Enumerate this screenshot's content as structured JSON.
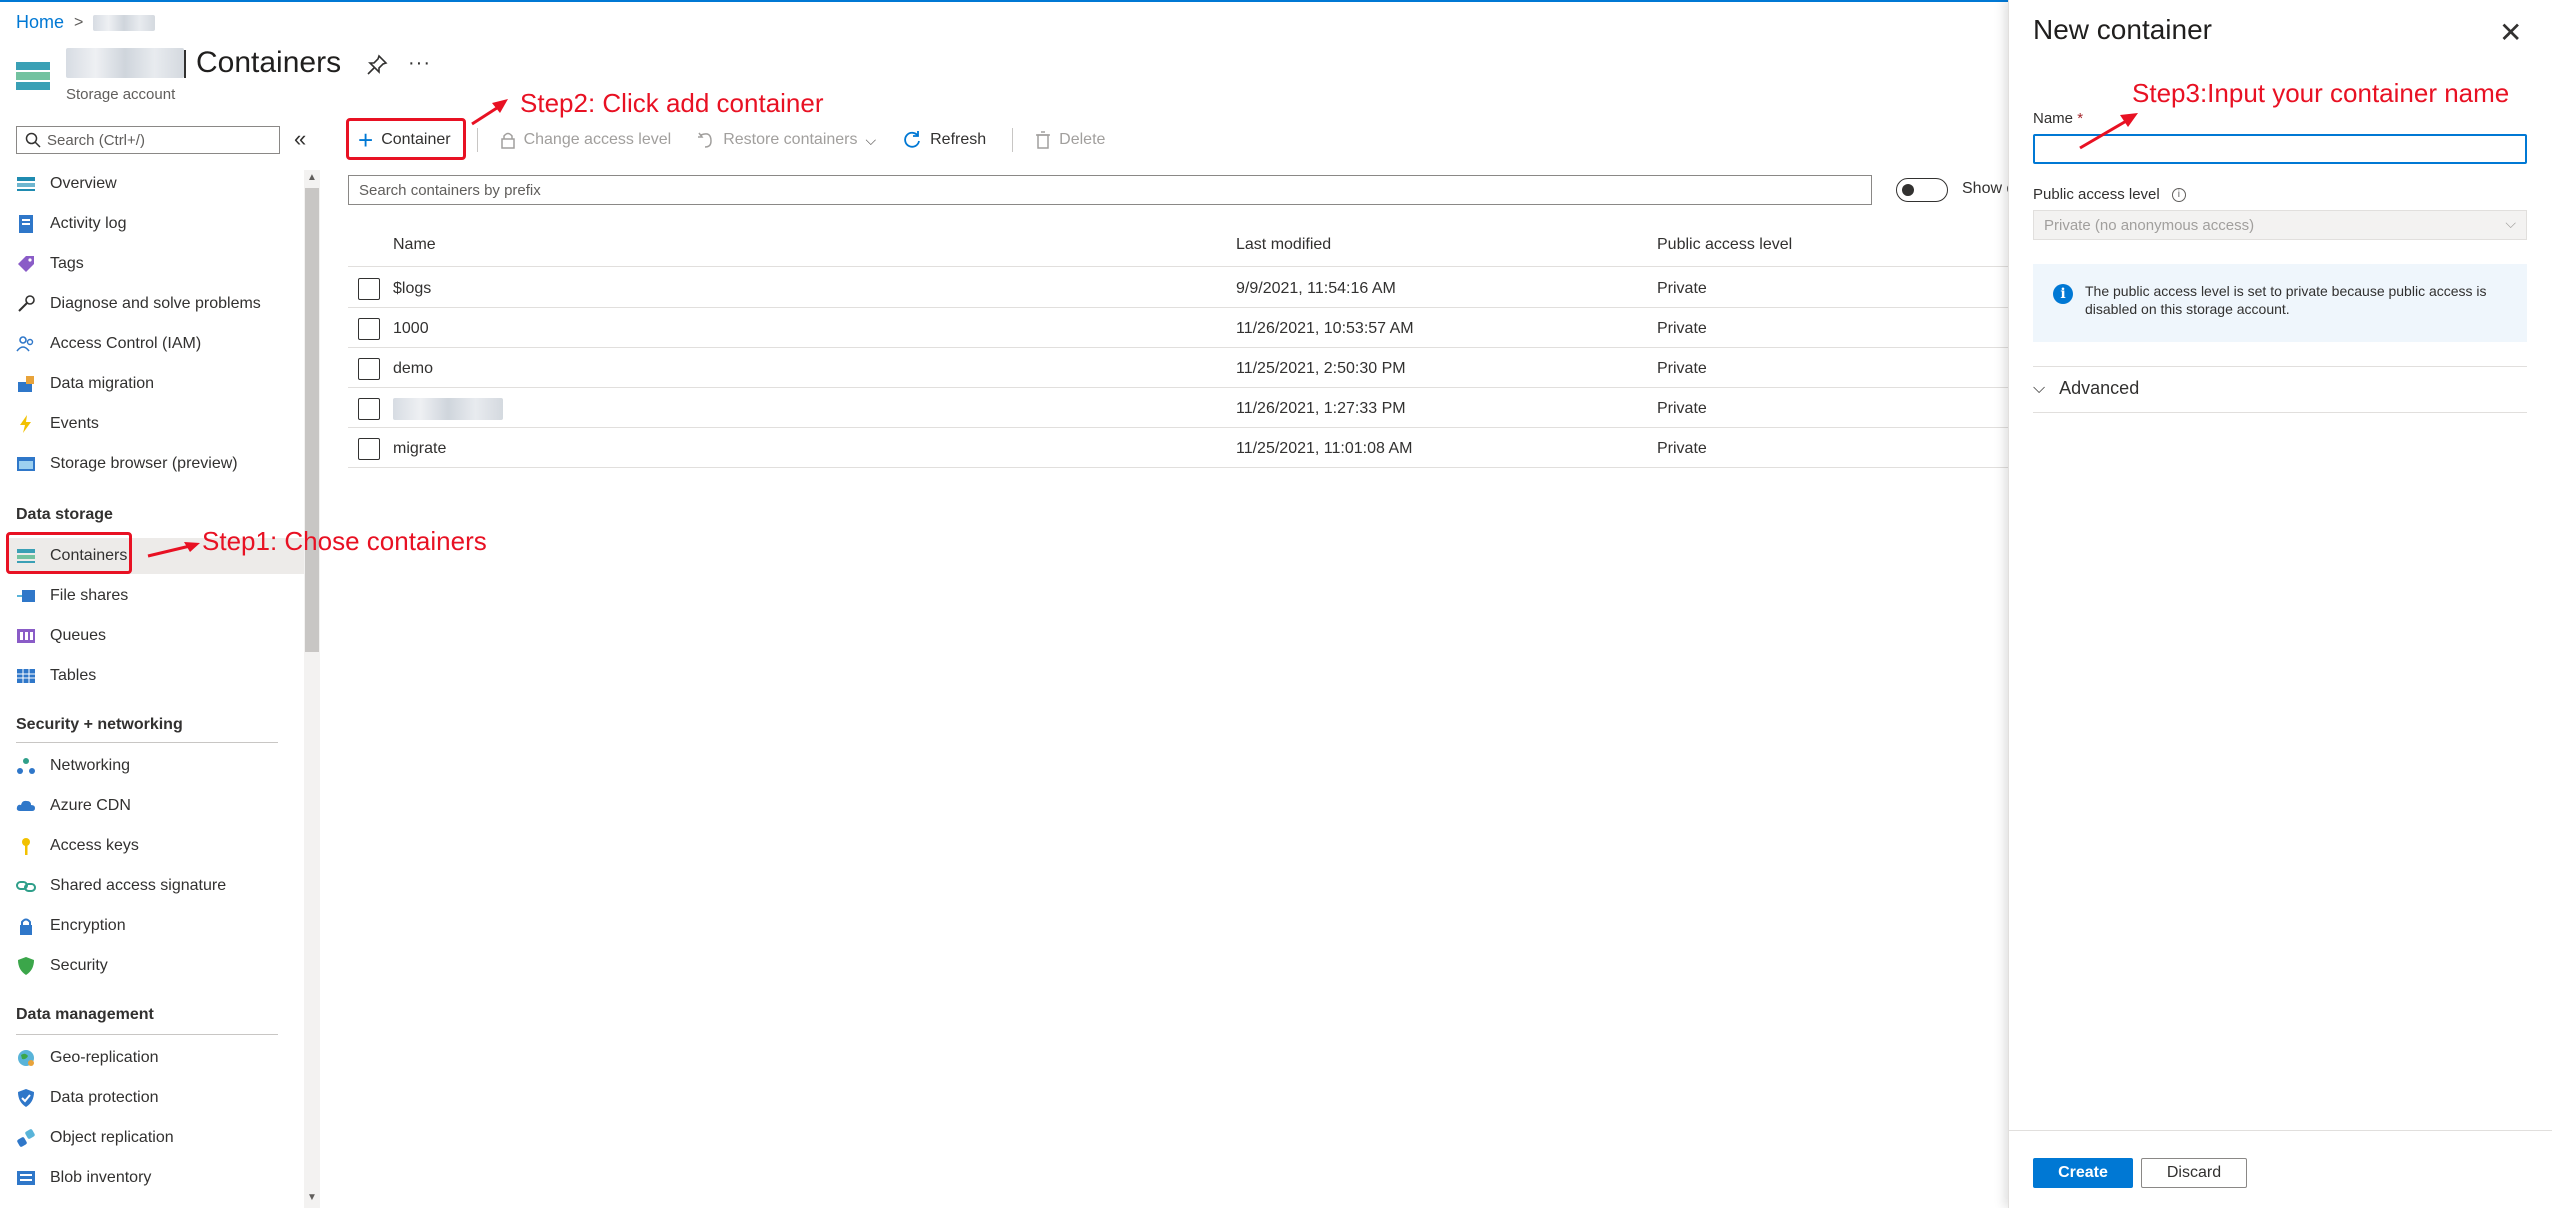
{
  "breadcrumb": {
    "home": "Home",
    "separator": ">"
  },
  "header": {
    "title": "Containers",
    "subtitle": "Storage account",
    "more": "···"
  },
  "sidebar": {
    "search_placeholder": "Search (Ctrl+/)",
    "collapse": "«",
    "top_items": [
      {
        "label": "Overview",
        "icon": "overview-icon"
      },
      {
        "label": "Activity log",
        "icon": "activity-log-icon"
      },
      {
        "label": "Tags",
        "icon": "tag-icon"
      },
      {
        "label": "Diagnose and solve problems",
        "icon": "wrench-icon"
      },
      {
        "label": "Access Control (IAM)",
        "icon": "people-icon"
      },
      {
        "label": "Data migration",
        "icon": "migration-icon"
      },
      {
        "label": "Events",
        "icon": "lightning-icon"
      },
      {
        "label": "Storage browser (preview)",
        "icon": "storage-browser-icon"
      }
    ],
    "sections": [
      {
        "title": "Data storage",
        "items": [
          {
            "label": "Containers",
            "icon": "containers-icon"
          },
          {
            "label": "File shares",
            "icon": "file-shares-icon"
          },
          {
            "label": "Queues",
            "icon": "queues-icon"
          },
          {
            "label": "Tables",
            "icon": "tables-icon"
          }
        ]
      },
      {
        "title": "Security + networking",
        "items": [
          {
            "label": "Networking",
            "icon": "networking-icon"
          },
          {
            "label": "Azure CDN",
            "icon": "cloud-icon"
          },
          {
            "label": "Access keys",
            "icon": "key-icon"
          },
          {
            "label": "Shared access signature",
            "icon": "link-icon"
          },
          {
            "label": "Encryption",
            "icon": "lock-icon"
          },
          {
            "label": "Security",
            "icon": "shield-icon"
          }
        ]
      },
      {
        "title": "Data management",
        "items": [
          {
            "label": "Geo-replication",
            "icon": "globe-icon"
          },
          {
            "label": "Data protection",
            "icon": "data-protection-icon"
          },
          {
            "label": "Object replication",
            "icon": "object-replication-icon"
          },
          {
            "label": "Blob inventory",
            "icon": "blob-inventory-icon"
          }
        ]
      }
    ]
  },
  "annotations": {
    "step1": "Step1: Chose containers",
    "step2": "Step2: Click add container",
    "step3": "Step3:Input your container name"
  },
  "toolbar": {
    "add": "Container",
    "change_access": "Change access level",
    "restore": "Restore containers",
    "refresh": "Refresh",
    "delete": "Delete"
  },
  "filter": {
    "placeholder": "Search containers by prefix",
    "show_label": "Show deleted containers"
  },
  "table": {
    "columns": [
      "Name",
      "Last modified",
      "Public access level"
    ],
    "rows": [
      {
        "name": "$logs",
        "modified": "9/9/2021, 11:54:16 AM",
        "access": "Private"
      },
      {
        "name": "1000",
        "modified": "11/26/2021, 10:53:57 AM",
        "access": "Private"
      },
      {
        "name": "demo",
        "modified": "11/25/2021, 2:50:30 PM",
        "access": "Private"
      },
      {
        "name": "",
        "modified": "11/26/2021, 1:27:33 PM",
        "access": "Private"
      },
      {
        "name": "migrate",
        "modified": "11/25/2021, 11:01:08 AM",
        "access": "Private"
      }
    ]
  },
  "panel": {
    "title": "New container",
    "close": "✕",
    "name_label": "Name",
    "required": "*",
    "access_label": "Public access level",
    "access_value": "Private (no anonymous access)",
    "info": "The public access level is set to private because public access is disabled on this storage account.",
    "advanced": "Advanced",
    "create": "Create",
    "discard": "Discard"
  },
  "colors": {
    "accent": "#0078d4",
    "annotation": "#e81123"
  }
}
